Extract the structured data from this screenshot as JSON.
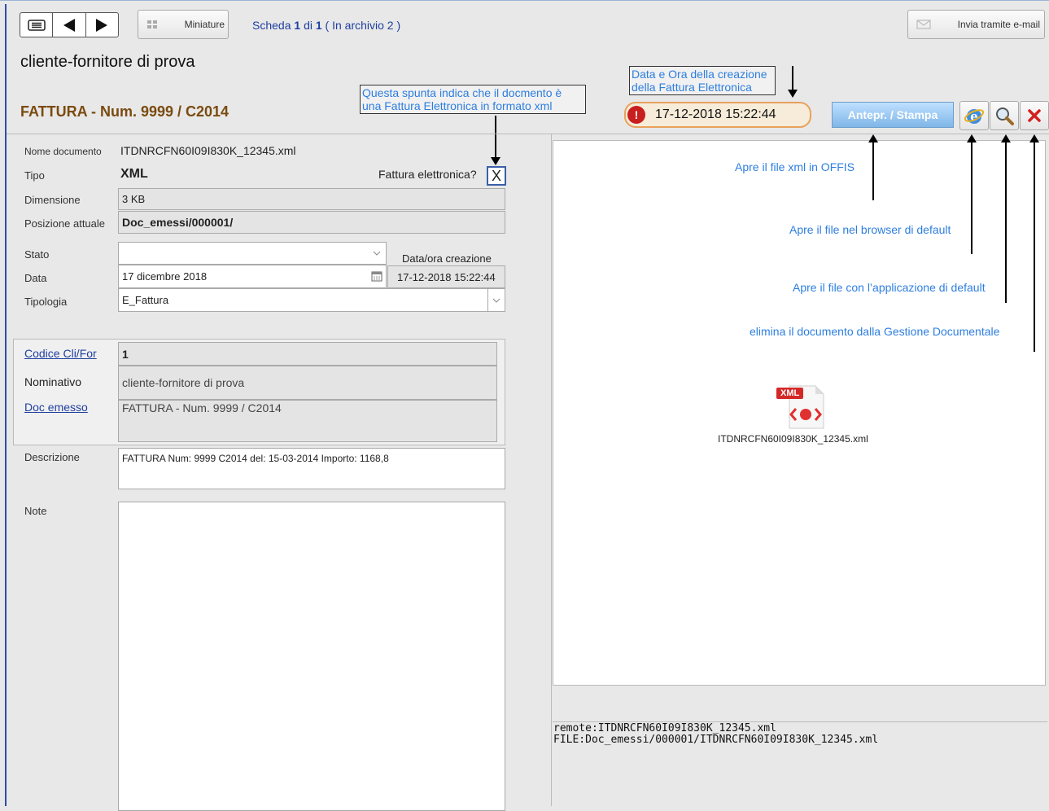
{
  "toolbar": {
    "miniature_label": "Miniature",
    "record_prefix": "Scheda",
    "record_current": "1",
    "record_of": "di",
    "record_total": "1",
    "record_archive": "( In archivio 2 )",
    "email_label": "Invia tramite e-mail"
  },
  "header": {
    "client_name": "cliente-fornitore di prova",
    "document_title": "FATTURA - Num. 9999 / C2014"
  },
  "callouts": {
    "electronic_flag_note": "Questa spunta indica che il docmento è una Fattura Elettronica in formato xml",
    "creation_date_note": "Data e Ora della creazione della Fattura Elettronica"
  },
  "creation_datetime": "17-12-2018 15:22:44",
  "actions": {
    "preview_print_label": "Antepr. / Stampa"
  },
  "form": {
    "labels": {
      "name": "Nome documento",
      "type": "Tipo",
      "size": "Dimensione",
      "position": "Posizione attuale",
      "state": "Stato",
      "date": "Data",
      "typology": "Tipologia",
      "creation": "Data/ora creazione",
      "electronic": "Fattura elettronica?",
      "code": "Codice Cli/For",
      "nominative": "Nominativo",
      "doc_issued": "Doc emesso",
      "description": "Descrizione",
      "notes": "Note"
    },
    "values": {
      "name": "ITDNRCFN60I09I830K_12345.xml",
      "type": "XML",
      "size": "3 KB",
      "position": "Doc_emessi/000001/",
      "state": "",
      "date": "17 dicembre 2018",
      "typology": "E_Fattura",
      "creation": "17-12-2018 15:22:44",
      "electronic_checked": "X",
      "code": "1",
      "nominative": "cliente-fornitore di prova",
      "doc_issued": "FATTURA - Num. 9999 / C2014",
      "description": "FATTURA Num: 9999 C2014 del: 15-03-2014 Importo: 1168,8",
      "notes": ""
    }
  },
  "annotations": {
    "offis": "Apre il file xml in OFFIS",
    "browser": "Apre il file nel browser di default",
    "app": "Apre il file con l’applicazione  di default",
    "delete": "elimina il documento dalla Gestione Documentale"
  },
  "preview": {
    "file_badge": "XML",
    "file_name": "ITDNRCFN60I09I830K_12345.xml"
  },
  "paths": {
    "remote": "remote:ITDNRCFN60I09I830K_12345.xml",
    "file": "FILE:Doc_emessi/000001/ITDNRCFN60I09I830K_12345.xml"
  },
  "colors": {
    "link": "#1f3fa0",
    "annotation": "#2d7ee0",
    "title": "#7a4b10",
    "accent_button": "#7fb6e8"
  }
}
